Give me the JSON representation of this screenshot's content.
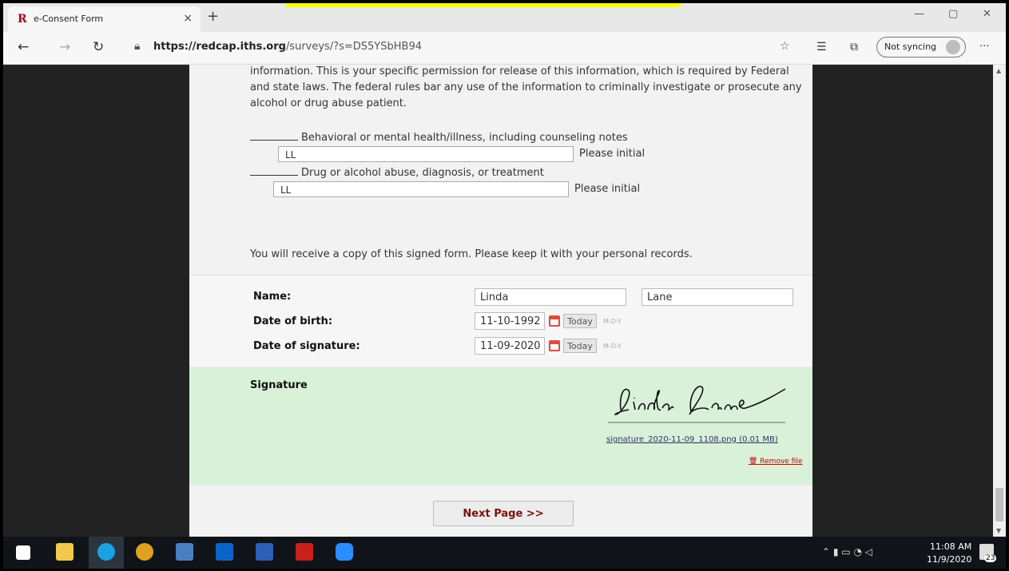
{
  "browser": {
    "tab_title": "e-Consent Form",
    "tab_close": "×",
    "new_tab": "+",
    "url_host": "https://redcap.iths.org",
    "url_path": "/surveys/?s=DS5YSbHB94",
    "sync_label": "Not syncing",
    "window_controls": [
      "—",
      "▢",
      "✕"
    ],
    "menu": "···"
  },
  "form": {
    "paragraph": "information. This is your specific permission for release of this information, which is required by Federal and state laws. The federal rules bar any use of the information to criminally investigate or prosecute any alcohol or drug abuse patient.",
    "items": [
      {
        "label": "Behavioral or mental health/illness, including counseling notes",
        "initial_value": "LL",
        "hint": "Please initial"
      },
      {
        "label": "Drug or alcohol abuse, diagnosis, or treatment",
        "initial_value": "LL",
        "hint": "Please initial"
      }
    ],
    "copy_note": "You will receive a copy of this signed form. Please keep it with your personal records.",
    "name_label": "Name:",
    "first_name": "Linda",
    "last_name": "Lane",
    "dob_label": "Date of birth:",
    "dob_value": "11-10-1992",
    "dos_label": "Date of signature:",
    "dos_value": "11-09-2020",
    "today_label": "Today",
    "date_format": "M-D-Y",
    "signature_label": "Signature",
    "signature_file": "signature_2020-11-09_1108.png (0.01 MB)",
    "remove_file": "Remove file",
    "next_button": "Next Page >>"
  },
  "taskbar": {
    "time": "11:08 AM",
    "date": "11/9/2020",
    "notification_count": "23",
    "icons": [
      "start-icon",
      "file-explorer-icon",
      "edge-icon",
      "chrome-icon",
      "snip-icon",
      "outlook-icon",
      "word-icon",
      "acrobat-icon",
      "zoom-icon"
    ]
  },
  "colors": {
    "signature_bg": "#d9f1d9",
    "next_text": "#7a1010",
    "calendar": "#e14a3e"
  }
}
